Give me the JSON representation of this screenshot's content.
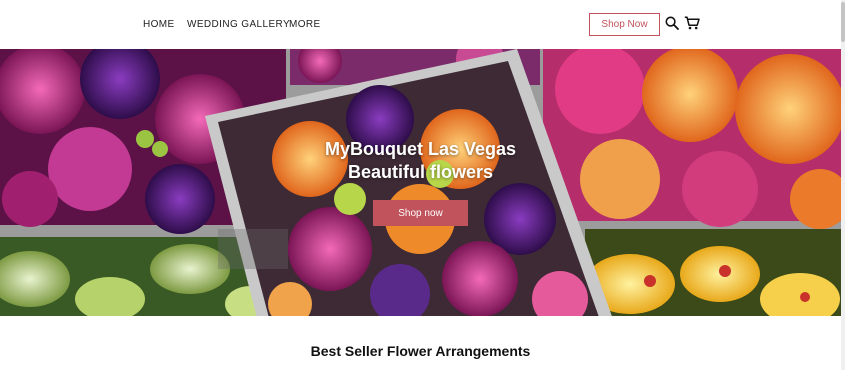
{
  "nav": {
    "home": "HOME",
    "wedding_gallery": "WEDDING GALLERY",
    "more": "MORE"
  },
  "header": {
    "shop_now_label": "Shop Now",
    "icons": [
      "search-icon",
      "cart-icon"
    ]
  },
  "hero": {
    "title_line_1": "MyBouquet Las Vegas",
    "title_line_2": "Beautiful flowers",
    "cta_label": "Shop now",
    "image_subject": "collage of flower bouquet photos"
  },
  "section": {
    "title": "Best Seller Flower Arrangements"
  },
  "colors": {
    "accent": "#c0535c",
    "text": "#222222",
    "background": "#ffffff"
  }
}
